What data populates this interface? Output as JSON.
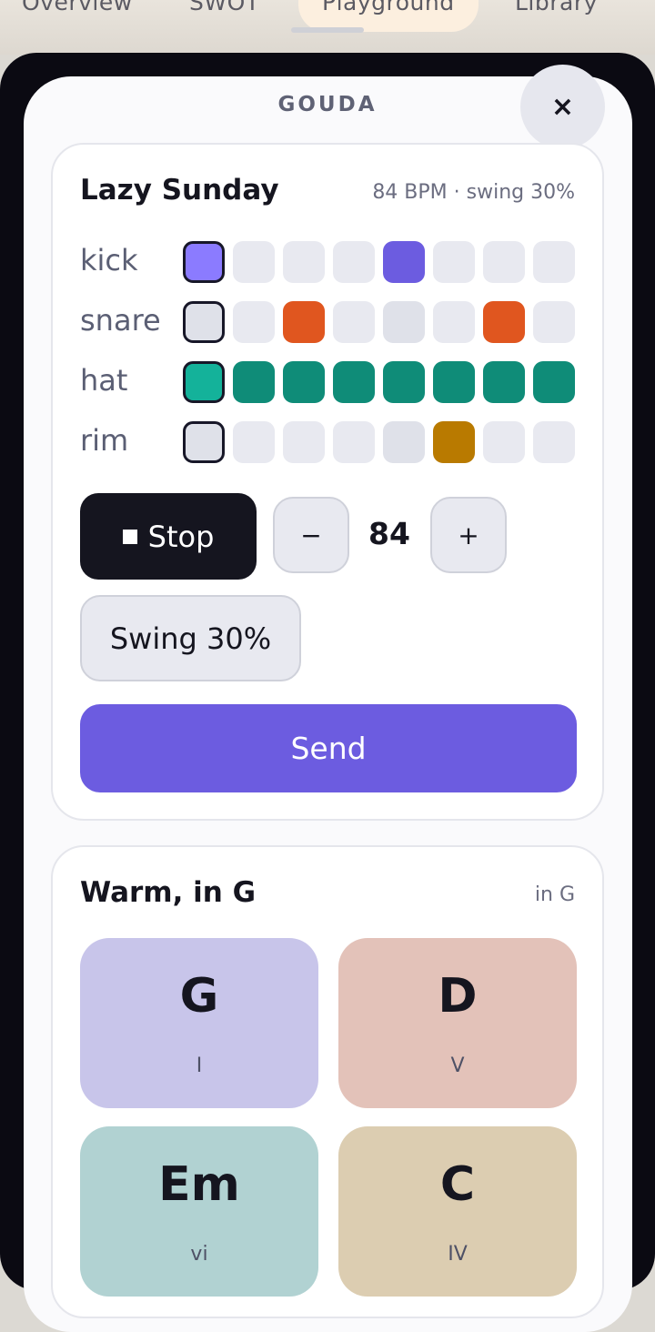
{
  "background_tabs": [
    "Overview",
    "SWOT",
    "Playground",
    "Library"
  ],
  "sheet": {
    "title": "GOUDA",
    "close_glyph": "×"
  },
  "beat": {
    "title": "Lazy Sunday",
    "meta": "84 BPM · swing 30%",
    "rows": [
      {
        "label": "kick",
        "steps": [
          1,
          0,
          0,
          0,
          1,
          0,
          0,
          0
        ],
        "color": "#6c5ce0",
        "active_color": "#8b7bff"
      },
      {
        "label": "snare",
        "steps": [
          0,
          0,
          1,
          0,
          0,
          0,
          1,
          0
        ],
        "color": "#e0561f",
        "active_color": "#e0561f"
      },
      {
        "label": "hat",
        "steps": [
          1,
          1,
          1,
          1,
          1,
          1,
          1,
          1
        ],
        "color": "#0f8c78",
        "active_color": "#14b29a"
      },
      {
        "label": "rim",
        "steps": [
          0,
          0,
          0,
          0,
          0,
          1,
          0,
          0
        ],
        "color": "#b97a00",
        "active_color": "#b97a00"
      }
    ],
    "playhead_step": 0,
    "dimmed_step": 4,
    "stop_label": "Stop",
    "minus_label": "−",
    "bpm": "84",
    "plus_label": "+",
    "swing_label": "Swing 30%",
    "send_label": "Send"
  },
  "chords": {
    "title": "Warm, in G",
    "meta": "in G",
    "items": [
      {
        "name": "G",
        "roman": "I",
        "color": "#c8c5ea"
      },
      {
        "name": "D",
        "roman": "V",
        "color": "#e3c2b9"
      },
      {
        "name": "Em",
        "roman": "vi",
        "color": "#b1d2d2"
      },
      {
        "name": "C",
        "roman": "IV",
        "color": "#dccdb1"
      }
    ]
  },
  "colors": {
    "accent": "#6c5ce0",
    "dark": "#15151f",
    "step_off": "#e8e9f0"
  }
}
